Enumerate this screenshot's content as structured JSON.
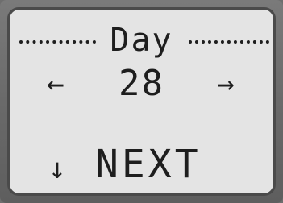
{
  "screen": {
    "title": "Day",
    "value": "28",
    "left_icon": "arrow-left-icon",
    "right_icon": "arrow-right-icon",
    "down_icon": "arrow-down-icon",
    "next_label": "NEXT"
  },
  "colors": {
    "lcd_background": "#e4e4e4",
    "lcd_text": "#1e1e1e",
    "bezel": "#6e6e6e"
  }
}
